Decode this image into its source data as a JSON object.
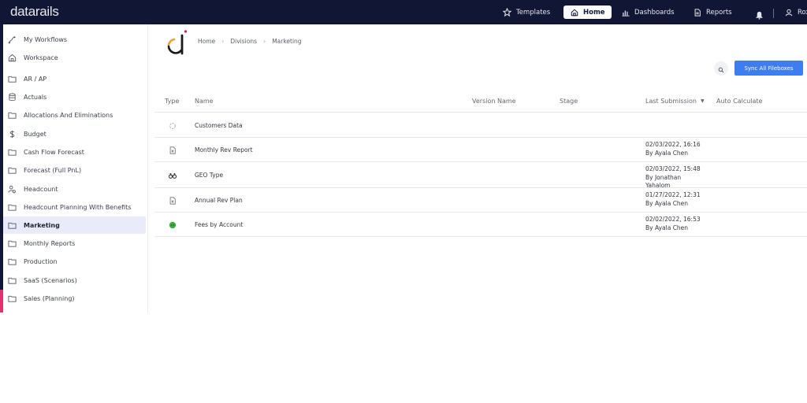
{
  "topbar": {
    "logo": "datarails",
    "nav": [
      {
        "label": "Templates",
        "icon": "star-icon",
        "active": false
      },
      {
        "label": "Home",
        "icon": "home-icon",
        "active": true
      },
      {
        "label": "Dashboards",
        "icon": "bar-chart-icon",
        "active": false
      },
      {
        "label": "Reports",
        "icon": "document-icon",
        "active": false
      }
    ],
    "notification_icon": "bell-icon",
    "user_label": "Roxa",
    "user_icon": "user-icon"
  },
  "sidebar": {
    "items": [
      {
        "label": "My Workflows",
        "icon": "workflow-icon",
        "active": false
      },
      {
        "label": "Workspace",
        "icon": "home-icon",
        "active": false
      },
      {
        "label": "AR / AP",
        "icon": "folder-icon",
        "active": false
      },
      {
        "label": "Actuals",
        "icon": "database-icon",
        "active": false
      },
      {
        "label": "Allocations And Eliminations",
        "icon": "folder-icon",
        "active": false
      },
      {
        "label": "Budget",
        "icon": "dollar-icon",
        "active": false
      },
      {
        "label": "Cash Flow Forecast",
        "icon": "folder-icon",
        "active": false
      },
      {
        "label": "Forecast (Full PnL)",
        "icon": "folder-icon",
        "active": false
      },
      {
        "label": "Headcount",
        "icon": "people-icon",
        "active": false
      },
      {
        "label": "Headcount Planning With Benefits",
        "icon": "folder-icon",
        "active": false
      },
      {
        "label": "Marketing",
        "icon": "folder-icon",
        "active": true
      },
      {
        "label": "Monthly Reports",
        "icon": "folder-icon",
        "active": false
      },
      {
        "label": "Production",
        "icon": "folder-icon",
        "active": false
      },
      {
        "label": "SaaS (Scenarios)",
        "icon": "folder-icon",
        "active": false
      },
      {
        "label": "Sales (Planning)",
        "icon": "folder-icon",
        "active": false
      }
    ]
  },
  "main": {
    "breadcrumb": [
      "Home",
      "Divisions",
      "Marketing"
    ],
    "sync_button": "Sync All Fileboxes",
    "search_icon": "search-icon",
    "table": {
      "columns": [
        "Type",
        "Name",
        "Version Name",
        "Stage",
        "Last Submission",
        "Auto Calculate"
      ],
      "sort_column": "Last Submission",
      "rows": [
        {
          "type_icon": "loading-icon",
          "name": "Customers Data",
          "version": "",
          "stage": "",
          "submission": [],
          "auto_calculate": ""
        },
        {
          "type_icon": "excel-file-icon",
          "name": "Monthly Rev Report",
          "version": "",
          "stage": "",
          "submission": [
            "02/03/2022, 16:16",
            "By Ayala Chen"
          ],
          "auto_calculate": ""
        },
        {
          "type_icon": "binoculars-icon",
          "name": "GEO Type",
          "version": "",
          "stage": "",
          "submission": [
            "02/03/2022, 15:48",
            "By Jonathan",
            "Yahalom"
          ],
          "auto_calculate": ""
        },
        {
          "type_icon": "excel-file-icon",
          "name": "Annual Rev Plan",
          "version": "",
          "stage": "",
          "submission": [
            "01/27/2022, 12:31",
            "By Ayala Chen"
          ],
          "auto_calculate": ""
        },
        {
          "type_icon": "green-status-icon",
          "name": "Fees by Account",
          "version": "",
          "stage": "",
          "submission": [
            "02/02/2022, 16:53",
            "By Ayala Chen"
          ],
          "auto_calculate": ""
        }
      ]
    }
  },
  "colors": {
    "topbar": "#111634",
    "accent_blue": "#3d7df0",
    "active_sidebar": "#e9eafa",
    "brand_orange": "#f0a030",
    "brand_red": "#d0204a",
    "status_green": "#3cae3c"
  }
}
